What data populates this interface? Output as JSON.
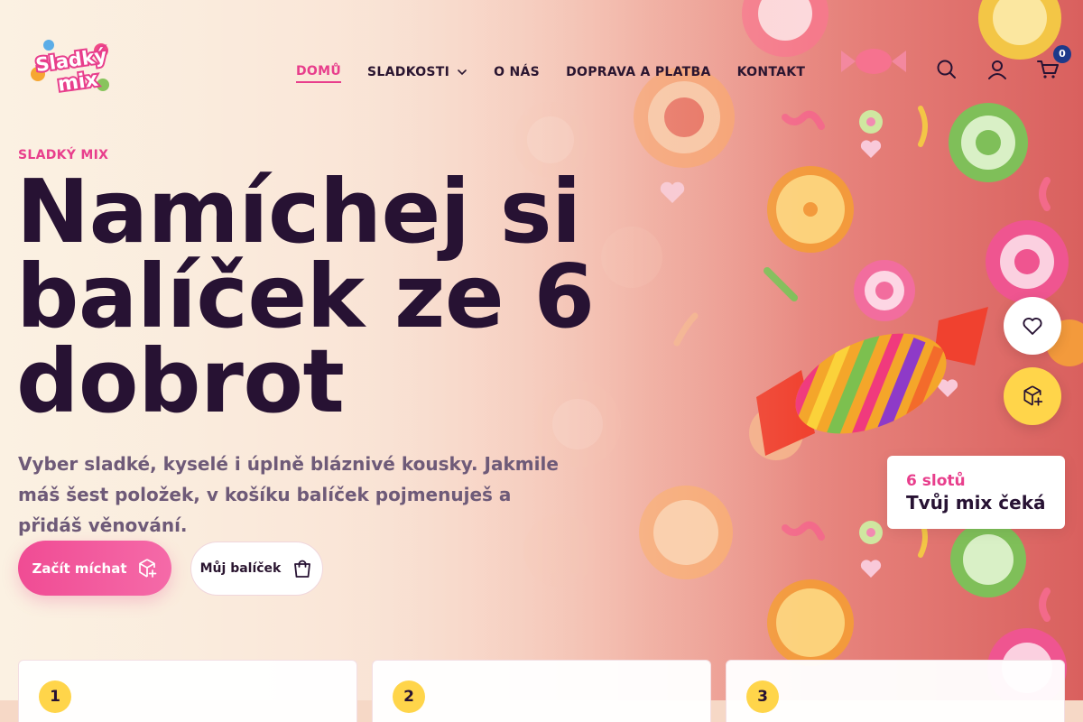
{
  "brand": {
    "logo_line1": "Sladký",
    "logo_line2": "mix"
  },
  "nav": {
    "items": [
      {
        "label": "DOMŮ",
        "active": true
      },
      {
        "label": "SLADKOSTI",
        "has_dropdown": true
      },
      {
        "label": "O NÁS"
      },
      {
        "label": "DOPRAVA A PLATBA"
      },
      {
        "label": "KONTAKT"
      }
    ]
  },
  "header": {
    "icons": [
      "search-icon",
      "user-icon",
      "cart-icon"
    ],
    "cart_count": "0"
  },
  "hero": {
    "eyebrow": "SLADKÝ MIX",
    "headline_line1": "Namíchej si",
    "headline_line2": "balíček ze 6",
    "headline_line3": "dobrot",
    "lead": "Vyber sladké, kyselé i úplně bláznivé kousky. Jakmile máš šest položek, v košíku balíček pojmenuješ a přidáš věnování.",
    "primary_button": "Začít míchat",
    "secondary_button": "Můj balíček"
  },
  "side": {
    "fab_icons": [
      "heart-icon",
      "box-add-icon"
    ],
    "card_slots": "6 slotů",
    "card_title": "Tvůj mix čeká"
  },
  "steps": [
    {
      "number": "1"
    },
    {
      "number": "2"
    },
    {
      "number": "3"
    }
  ],
  "colors": {
    "accent": "#e83e8c",
    "dark": "#271233",
    "yellow": "#ffd54a",
    "badge": "#1d3a8a"
  }
}
